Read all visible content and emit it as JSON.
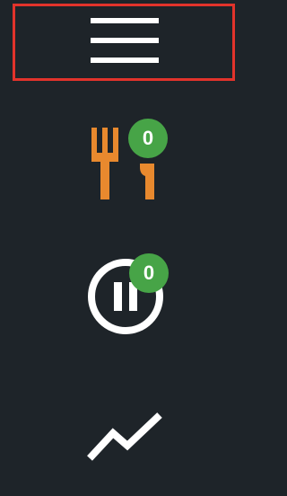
{
  "menu": {
    "icon": "hamburger-menu-icon",
    "highlight_color": "#e2332b"
  },
  "nav": {
    "items": [
      {
        "id": "orders",
        "icon": "fork-knife-icon",
        "icon_color": "#e8892e",
        "badge": "0",
        "badge_color": "#47a447"
      },
      {
        "id": "paused",
        "icon": "pause-circle-icon",
        "icon_color": "#ffffff",
        "badge": "0",
        "badge_color": "#47a447"
      },
      {
        "id": "analytics",
        "icon": "trend-line-icon",
        "icon_color": "#ffffff"
      }
    ]
  },
  "theme": {
    "background": "#1e2429"
  }
}
